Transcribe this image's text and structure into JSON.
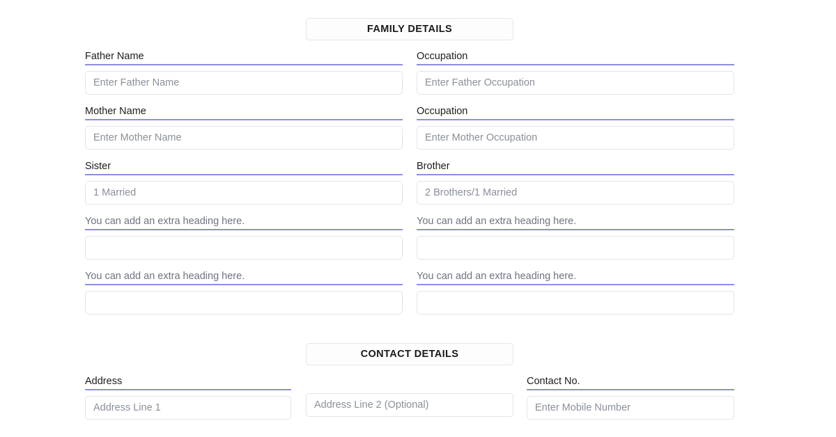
{
  "theme": {
    "page_background": "#ffffff",
    "label_underline_color": "#8d8de4",
    "input_border_color": "#e4e4ea",
    "placeholder_color": "#8a9099",
    "label_color": "#1c1c1f",
    "muted_label_color": "#6d7480",
    "header_border_color": "#e6e6ea"
  },
  "sections": {
    "family": {
      "header": "FAMILY DETAILS",
      "fields": [
        {
          "label": "Father Name",
          "placeholder": "Enter Father Name",
          "value": "",
          "muted": false
        },
        {
          "label": "Occupation",
          "placeholder": "Enter Father Occupation",
          "value": "",
          "muted": false
        },
        {
          "label": "Mother Name",
          "placeholder": "Enter Mother Name",
          "value": "",
          "muted": false
        },
        {
          "label": "Occupation",
          "placeholder": "Enter Mother Occupation",
          "value": "",
          "muted": false
        },
        {
          "label": "Sister",
          "placeholder": "1 Married",
          "value": "",
          "muted": false
        },
        {
          "label": "Brother",
          "placeholder": "2 Brothers/1 Married",
          "value": "",
          "muted": false
        },
        {
          "label": "You can add an extra heading here.",
          "placeholder": "",
          "value": "",
          "muted": true
        },
        {
          "label": "You can add an extra heading here.",
          "placeholder": "",
          "value": "",
          "muted": true
        },
        {
          "label": "You can add an extra heading here.",
          "placeholder": "",
          "value": "",
          "muted": true
        },
        {
          "label": "You can add an extra heading here.",
          "placeholder": "",
          "value": "",
          "muted": true
        }
      ]
    },
    "contact": {
      "header": "CONTACT DETAILS",
      "address": {
        "label": "Address",
        "line1_placeholder": "Address Line 1",
        "line1_value": "",
        "line2_placeholder": "Address Line 2 (Optional)",
        "line2_value": ""
      },
      "contact_no": {
        "label": "Contact No.",
        "placeholder": "Enter Mobile Number",
        "value": ""
      }
    }
  }
}
